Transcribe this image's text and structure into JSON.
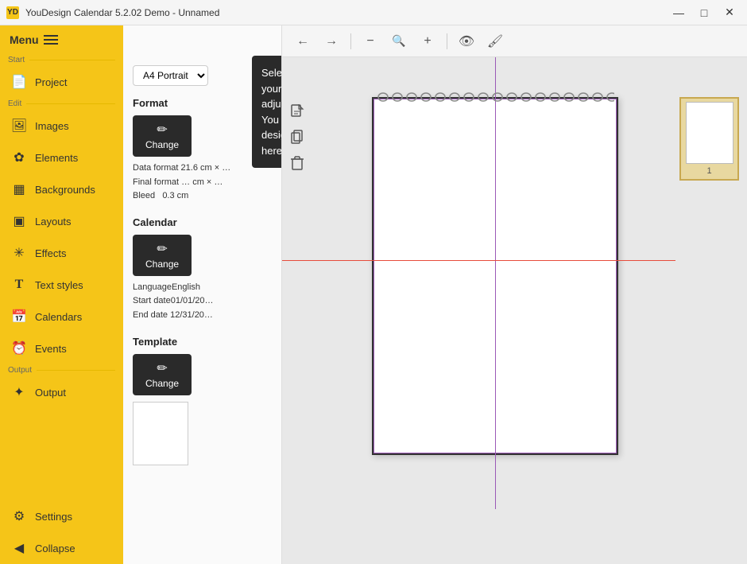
{
  "titlebar": {
    "icon_text": "YD",
    "title": "YouDesign Calendar 5.2.02 Demo - Unnamed",
    "min_label": "—",
    "max_label": "□",
    "close_label": "✕"
  },
  "sidebar": {
    "menu_label": "Menu",
    "sections": {
      "start_label": "Start",
      "edit_label": "Edit",
      "output_label": "Output"
    },
    "items": [
      {
        "id": "project",
        "label": "Project",
        "icon": "📄"
      },
      {
        "id": "images",
        "label": "Images",
        "icon": "🖼"
      },
      {
        "id": "elements",
        "label": "Elements",
        "icon": "✿"
      },
      {
        "id": "backgrounds",
        "label": "Backgrounds",
        "icon": "▦"
      },
      {
        "id": "layouts",
        "label": "Layouts",
        "icon": "▣"
      },
      {
        "id": "effects",
        "label": "Effects",
        "icon": "✳"
      },
      {
        "id": "text-styles",
        "label": "Text styles",
        "icon": "T"
      },
      {
        "id": "calendars",
        "label": "Calendars",
        "icon": "📅"
      },
      {
        "id": "events",
        "label": "Events",
        "icon": "⏰"
      },
      {
        "id": "output",
        "label": "Output",
        "icon": "✦"
      }
    ],
    "settings_label": "Settings",
    "collapse_label": "Collapse"
  },
  "tooltip": {
    "text": "Select a format for your project and adjust all settings. You can also select a design template here.",
    "close_label": "✕"
  },
  "panel": {
    "format_dropdown_value": "A4 Portrait",
    "format_section": {
      "title": "Format",
      "button_label": "Change",
      "data_format_label": "Data format",
      "data_format_value": "21.6 cm × …",
      "final_format_label": "Final format",
      "final_format_value": "… cm × …",
      "bleed_label": "Bleed",
      "bleed_value": "0.3 cm"
    },
    "calendar_section": {
      "title": "Calendar",
      "button_label": "Change",
      "language_label": "Language",
      "language_value": "English",
      "start_date_label": "Start date",
      "start_date_value": "01/01/20…",
      "end_date_label": "End date",
      "end_date_value": "12/31/20…"
    },
    "template_section": {
      "title": "Template",
      "button_label": "Change"
    }
  },
  "toolbar": {
    "back_icon": "←",
    "forward_icon": "→",
    "zoom_out_icon": "−",
    "zoom_in_icon": "+",
    "search_icon": "🔍",
    "eye_icon": "👁",
    "paint_icon": "🖌"
  },
  "thumbnail": {
    "number": "1"
  }
}
